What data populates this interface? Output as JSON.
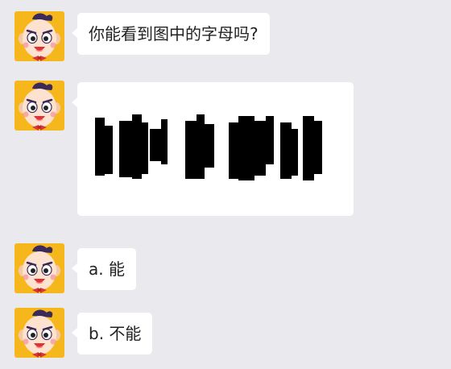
{
  "messages": [
    {
      "type": "text",
      "text": "你能看到图中的字母吗?"
    },
    {
      "type": "image",
      "image_content": "black-blocky-letters-puzzle"
    },
    {
      "type": "text",
      "text": "a. 能"
    },
    {
      "type": "text",
      "text": "b. 不能"
    }
  ],
  "colors": {
    "background": "#e9e9ee",
    "bubble": "#ffffff",
    "avatar_bg": "#f5b71c",
    "text": "#222222",
    "puzzle_block": "#000000"
  }
}
